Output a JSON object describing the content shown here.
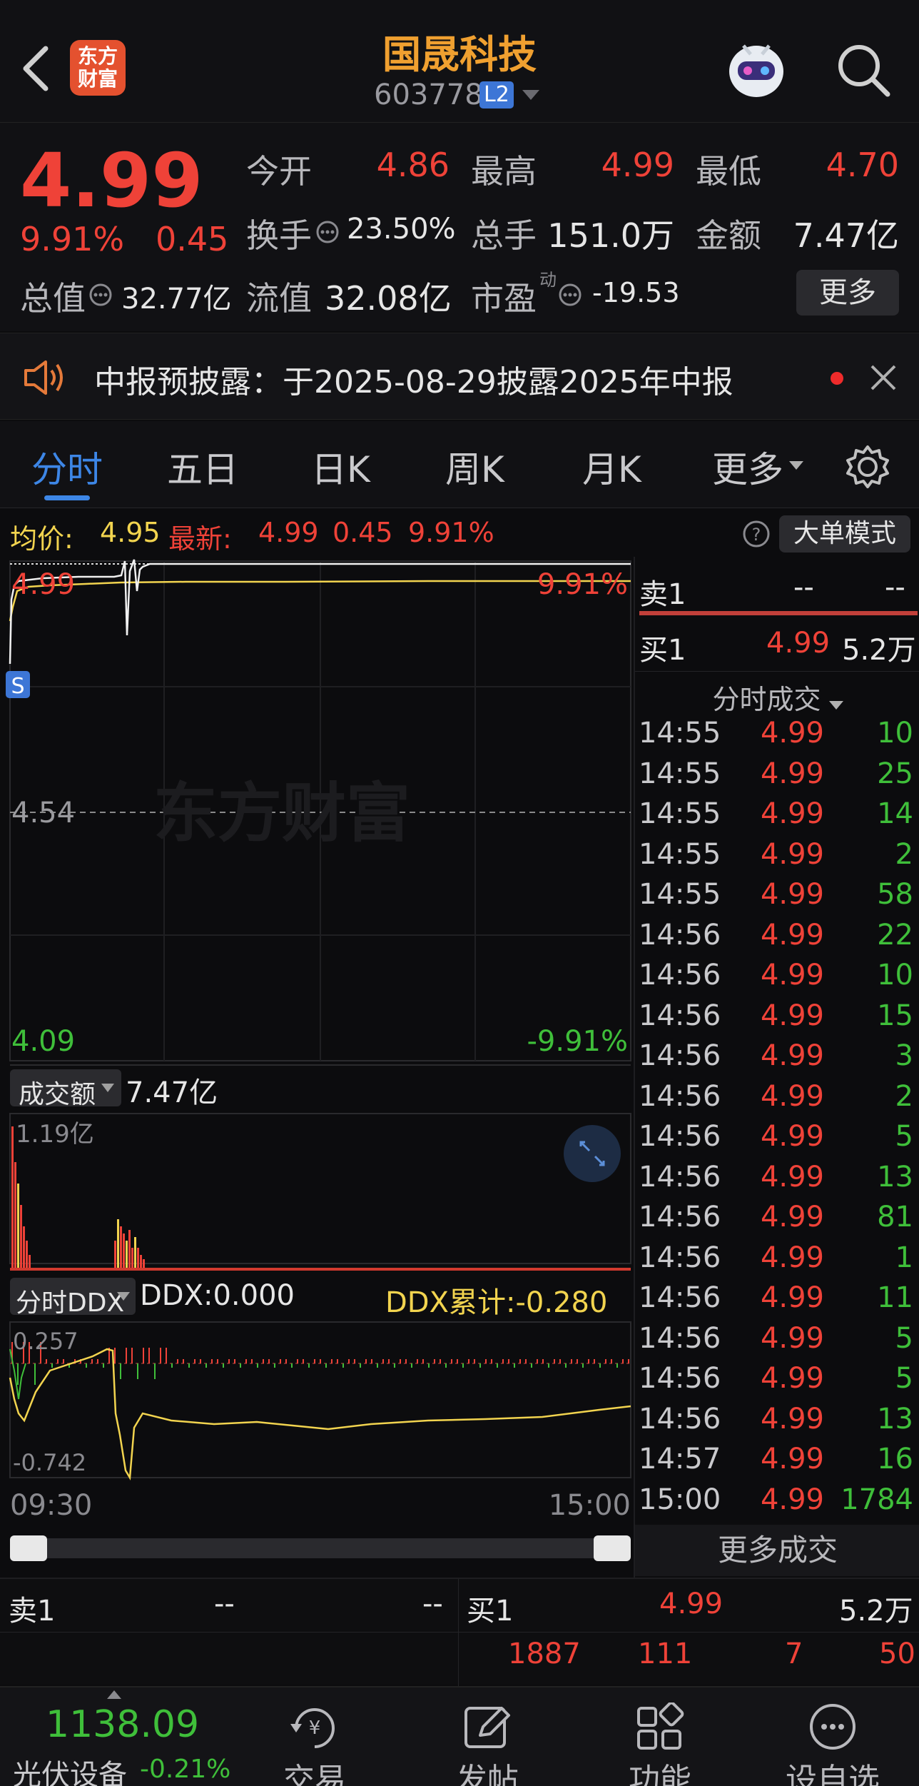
{
  "header": {
    "title": "国晟科技",
    "code": "603778",
    "badge": "L2",
    "logo_text": "东方财富",
    "back_icon": "chevron-left-icon",
    "search_icon": "search-icon",
    "robot_icon": "robot-avatar-icon"
  },
  "quote": {
    "price": "4.99",
    "change_pct": "9.91%",
    "change_amt": "0.45",
    "open_label": "今开",
    "open": "4.86",
    "high_label": "最高",
    "high": "4.99",
    "low_label": "最低",
    "low": "4.70",
    "turnover_label": "换手",
    "turnover": "23.50%",
    "volume_label": "总手",
    "volume": "151.0万",
    "amount_label": "金额",
    "amount": "7.47亿",
    "mktcap_label": "总值",
    "mktcap": "32.77亿",
    "float_label": "流值",
    "float": "32.08亿",
    "pe_label": "市盈",
    "pe_sup": "动",
    "pe": "-19.53",
    "more_button": "更多"
  },
  "notice": {
    "text": "中报预披露：于2025-08-29披露2025年中报",
    "speaker_icon": "speaker-icon",
    "close_icon": "close-icon"
  },
  "tabs": [
    {
      "label": "分时",
      "active": true
    },
    {
      "label": "五日",
      "active": false
    },
    {
      "label": "日K",
      "active": false
    },
    {
      "label": "周K",
      "active": false
    },
    {
      "label": "月K",
      "active": false
    },
    {
      "label": "更多",
      "active": false
    }
  ],
  "settings_icon": "gear-icon",
  "info_bar": {
    "avg_label": "均价:",
    "avg": "4.95",
    "last_label": "最新:",
    "last": "4.99",
    "last_chg": "0.45",
    "last_pct": "9.91%",
    "help_icon": "question-icon",
    "mode_button": "大单模式"
  },
  "price_axis": {
    "top": "4.99",
    "top_pct": "9.91%",
    "mid": "4.54",
    "bottom": "4.09",
    "bottom_pct": "-9.91%"
  },
  "watermark": "东方财富",
  "s_badge": "S",
  "volume_panel": {
    "selector": "成交额",
    "total": "7.47亿",
    "max_label": "1.19亿",
    "expand_icon": "expand-icon"
  },
  "ddx_panel": {
    "selector": "分时DDX",
    "ddx": "DDX:0.000",
    "ddx_cum": "DDX累计:-0.280",
    "top": "0.257",
    "bottom": "-0.742"
  },
  "time_axis": {
    "start": "09:30",
    "end": "15:00"
  },
  "order_book_side": {
    "sell1_label": "卖1",
    "sell1_price": "--",
    "sell1_vol": "--",
    "buy1_label": "买1",
    "buy1_price": "4.99",
    "buy1_vol": "5.2万"
  },
  "trades_header": "分时成交",
  "trades": [
    {
      "time": "14:55",
      "price": "4.99",
      "vol": "10"
    },
    {
      "time": "14:55",
      "price": "4.99",
      "vol": "25"
    },
    {
      "time": "14:55",
      "price": "4.99",
      "vol": "14"
    },
    {
      "time": "14:55",
      "price": "4.99",
      "vol": "2"
    },
    {
      "time": "14:55",
      "price": "4.99",
      "vol": "58"
    },
    {
      "time": "14:56",
      "price": "4.99",
      "vol": "22"
    },
    {
      "time": "14:56",
      "price": "4.99",
      "vol": "10"
    },
    {
      "time": "14:56",
      "price": "4.99",
      "vol": "15"
    },
    {
      "time": "14:56",
      "price": "4.99",
      "vol": "3"
    },
    {
      "time": "14:56",
      "price": "4.99",
      "vol": "2"
    },
    {
      "time": "14:56",
      "price": "4.99",
      "vol": "5"
    },
    {
      "time": "14:56",
      "price": "4.99",
      "vol": "13"
    },
    {
      "time": "14:56",
      "price": "4.99",
      "vol": "81"
    },
    {
      "time": "14:56",
      "price": "4.99",
      "vol": "1"
    },
    {
      "time": "14:56",
      "price": "4.99",
      "vol": "11"
    },
    {
      "time": "14:56",
      "price": "4.99",
      "vol": "5"
    },
    {
      "time": "14:56",
      "price": "4.99",
      "vol": "5"
    },
    {
      "time": "14:56",
      "price": "4.99",
      "vol": "13"
    },
    {
      "time": "14:57",
      "price": "4.99",
      "vol": "16"
    },
    {
      "time": "15:00",
      "price": "4.99",
      "vol": "1784"
    }
  ],
  "more_trades": "更多成交",
  "bottom_book": {
    "sell1_label": "卖1",
    "sell1_price": "--",
    "sell1_vol": "--",
    "buy1_label": "买1",
    "buy1_price": "4.99",
    "buy1_vol": "5.2万",
    "row2": [
      "1887",
      "111",
      "7",
      "50"
    ]
  },
  "bottom_nav": {
    "index_value": "1138.09",
    "index_name": "光伏设备",
    "index_chg": "-0.21%",
    "items": [
      {
        "label": "交易",
        "icon": "yen-exchange-icon"
      },
      {
        "label": "发帖",
        "icon": "edit-icon"
      },
      {
        "label": "功能",
        "icon": "grid-apps-icon"
      },
      {
        "label": "设自选",
        "icon": "more-dots-icon"
      }
    ]
  },
  "colors": {
    "up": "#ef4238",
    "down": "#3fbf3a",
    "accent": "#3d86e6",
    "avg_line": "#f2d44f"
  }
}
